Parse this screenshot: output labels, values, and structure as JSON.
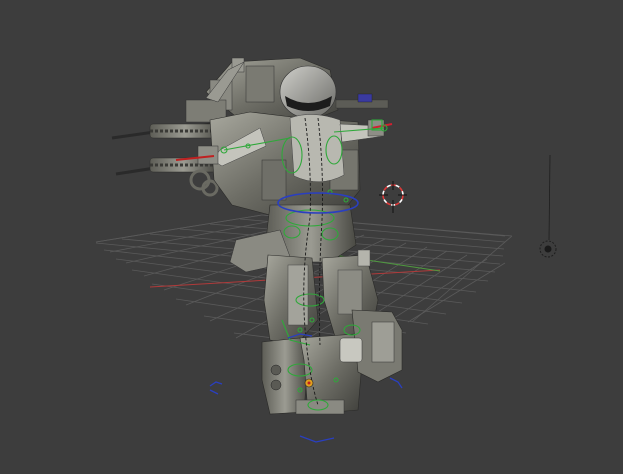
{
  "viewport": {
    "background": "#3d3d3d",
    "grid_color": "#5a5a5a",
    "x_axis_color": "#b03a3a",
    "y_axis_color": "#4f9a3f",
    "rig_color": "#2fa83a",
    "selection_ring_color": "#2a3fc0",
    "bound_color": "#2a3fc0",
    "cursor_red": "#e03a3a"
  },
  "scene": {
    "model": "mech-robot-mesh",
    "armature": "robot-rig",
    "cursor": "3d-cursor",
    "lamp": "lamp-object"
  }
}
